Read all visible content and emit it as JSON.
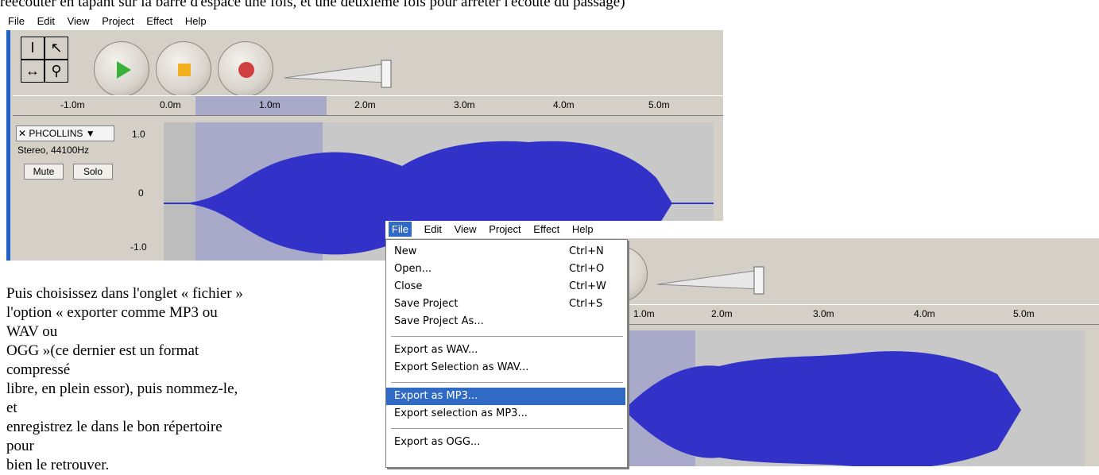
{
  "intro_text": "réécouter en tapant sur la barre d'espace une fois, et une deuxième fois pour arrêter l'écoute du passage)",
  "menubar": [
    "File",
    "Edit",
    "View",
    "Project",
    "Effect",
    "Help"
  ],
  "ruler_ticks": [
    "-1.0m",
    "0.0m",
    "1.0m",
    "2.0m",
    "3.0m",
    "4.0m",
    "5.0m"
  ],
  "ruler_ticks_2": [
    "1.0m",
    "2.0m",
    "3.0m",
    "4.0m",
    "5.0m"
  ],
  "track": {
    "name": "PHCOLLINS ▼",
    "info": "Stereo, 44100Hz",
    "mute_label": "Mute",
    "solo_label": "Solo",
    "scale_top": "1.0",
    "scale_mid": "0",
    "scale_bottom": "-1.0"
  },
  "paragraph": [
    "Puis choisissez dans l'onglet « fichier »",
    "l'option « exporter comme MP3 ou WAV ou",
    "OGG »(ce dernier est un format compressé",
    "libre, en plein essor), puis nommez-le, et",
    "enregistrez le dans le bon répertoire pour",
    "bien le retrouver."
  ],
  "file_menu": {
    "items": [
      {
        "label": "New",
        "shortcut": "Ctrl+N"
      },
      {
        "label": "Open...",
        "shortcut": "Ctrl+O"
      },
      {
        "label": "Close",
        "shortcut": "Ctrl+W"
      },
      {
        "label": "Save Project",
        "shortcut": "Ctrl+S"
      },
      {
        "label": "Save Project As...",
        "shortcut": ""
      },
      {
        "label": "Export as WAV...",
        "shortcut": ""
      },
      {
        "label": "Export Selection as WAV...",
        "shortcut": ""
      },
      {
        "label": "Export as MP3...",
        "shortcut": ""
      },
      {
        "label": "Export selection as MP3...",
        "shortcut": ""
      },
      {
        "label": "Export as OGG...",
        "shortcut": ""
      }
    ],
    "highlighted_item": "Export as MP3..."
  },
  "colors": {
    "waveform": "#3232c8",
    "selection": "#a9a9c9",
    "highlight": "#316ac5",
    "panel": "#d4d0c8"
  }
}
